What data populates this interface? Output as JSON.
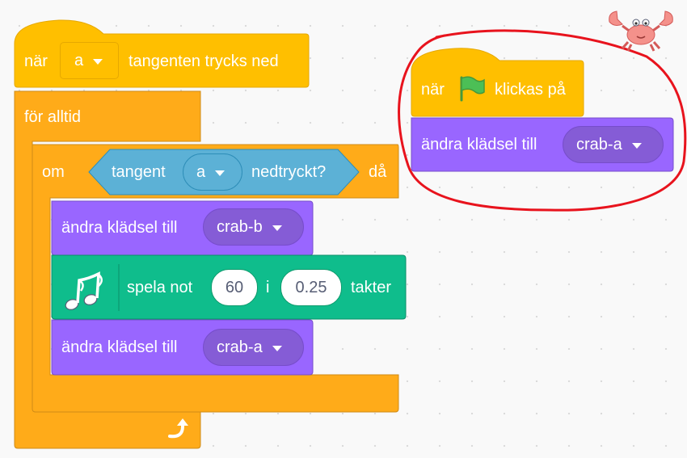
{
  "script_left": {
    "hat": {
      "prefix": "när",
      "key_value": "a",
      "suffix": "tangenten trycks ned"
    },
    "forever": {
      "label": "för alltid"
    },
    "if_block": {
      "prefix": "om",
      "suffix": "då",
      "condition": {
        "prefix": "tangent",
        "key_value": "a",
        "suffix": "nedtryckt?"
      }
    },
    "switch_costume_1": {
      "label": "ändra klädsel till",
      "costume": "crab-b"
    },
    "play_note": {
      "prefix": "spela not",
      "note": "60",
      "middle": "i",
      "beats": "0.25",
      "suffix": "takter",
      "icon": "music-notes-icon"
    },
    "switch_costume_2": {
      "label": "ändra klädsel till",
      "costume": "crab-a"
    },
    "loop_icon": "repeat-arrow-icon"
  },
  "script_right": {
    "flag_hat": {
      "prefix": "när",
      "suffix": "klickas på",
      "icon": "green-flag-icon"
    },
    "switch_costume": {
      "label": "ändra klädsel till",
      "costume": "crab-a"
    },
    "highlight_color": "#e8131d"
  },
  "sprite": {
    "icon": "crab-sprite-icon"
  },
  "colors": {
    "events": "#ffbf00",
    "events_border": "#e6a800",
    "control": "#ffab19",
    "control_border": "#cf8b17",
    "sensing": "#5cb1d6",
    "sensing_border": "#2e8eb8",
    "looks": "#9966ff",
    "looks_border": "#774dcb",
    "sound": "#0fbd8c",
    "sound_border": "#0b8e69",
    "workspace": "#f9f9f9"
  }
}
